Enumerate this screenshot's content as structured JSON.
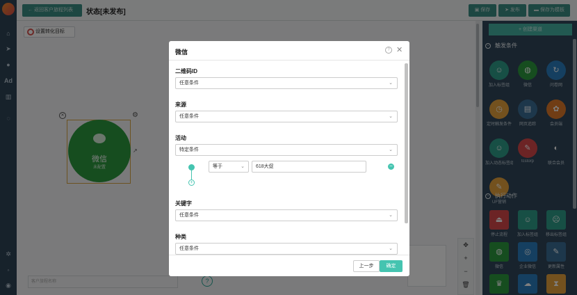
{
  "topbar": {
    "back_label": "返回客户旅程列表",
    "state_title": "状态[未发布]",
    "save_label": "保存",
    "publish_label": "发布",
    "save_template_label": "保存为模板"
  },
  "canvas": {
    "goal_button": "设置转化目标",
    "node": {
      "name": "微信",
      "status": "未配置"
    },
    "name_placeholder": "客户旅程名称"
  },
  "sidebar": {
    "new_button": "+ 创建渠道",
    "trigger_section": "触发条件",
    "trigger_items": [
      {
        "label": "加入标签组",
        "icon": "user-plus-icon",
        "color": "#2f9e8a"
      },
      {
        "label": "微信",
        "icon": "wechat-icon",
        "color": "#2c9a3f"
      },
      {
        "label": "问卷网",
        "icon": "survey-icon",
        "color": "#2a7fc0"
      },
      {
        "label": "定时触发条件",
        "icon": "clock-icon",
        "color": "#e6a23c"
      },
      {
        "label": "网页追踪",
        "icon": "webpage-icon",
        "color": "#3b6f96"
      },
      {
        "label": "会员端",
        "icon": "member-icon",
        "color": "#e07b2a"
      },
      {
        "label": "加入动态标签组",
        "icon": "user-dynamic-icon",
        "color": "#2f9e8a"
      },
      {
        "label": "tcstorp",
        "icon": "wrench-icon",
        "color": "#d9484b"
      },
      {
        "label": "联合会员",
        "icon": "union-member-icon",
        "color": "#31475a"
      },
      {
        "label": "UF营销",
        "icon": "wrench-orange-icon",
        "color": "#e6a23c"
      }
    ],
    "action_section": "执行动作",
    "action_items": [
      {
        "label": "停止流程",
        "icon": "eject-icon",
        "color": "#d9484b"
      },
      {
        "label": "加入标签组",
        "icon": "user-plus-icon",
        "color": "#2f9e8a"
      },
      {
        "label": "移出标签组",
        "icon": "user-minus-icon",
        "color": "#2f9e8a"
      },
      {
        "label": "微信",
        "icon": "wechat-icon",
        "color": "#2c9a3f"
      },
      {
        "label": "企业微信",
        "icon": "work-wechat-icon",
        "color": "#2a7fc0"
      },
      {
        "label": "更新属性",
        "icon": "edit-icon",
        "color": "#3b6f96"
      },
      {
        "label": "",
        "icon": "trophy-icon",
        "color": "#2c9a3f"
      },
      {
        "label": "",
        "icon": "cloud-icon",
        "color": "#2a7fc0"
      },
      {
        "label": "",
        "icon": "hourglass-icon",
        "color": "#e6a23c"
      }
    ]
  },
  "zoom": {
    "fit": "✥",
    "in": "+",
    "out": "−",
    "delete": "🗑"
  },
  "modal": {
    "title": "微信",
    "help": "?",
    "close": "✕",
    "fields": [
      {
        "label": "二维码ID",
        "value": "任意条件"
      },
      {
        "label": "来源",
        "value": "任意条件"
      },
      {
        "label": "活动",
        "value": "特定条件"
      },
      {
        "label": "关键字",
        "value": "任意条件"
      },
      {
        "label": "种类",
        "value": "任意条件"
      }
    ],
    "rule": {
      "operator": "等于",
      "value": "618大促"
    },
    "prev_button": "上一步",
    "ok_button": "确定"
  },
  "colors": {
    "accent": "#45c4b0",
    "sidebar": "#31475a",
    "node_green": "#2c9a3f"
  }
}
